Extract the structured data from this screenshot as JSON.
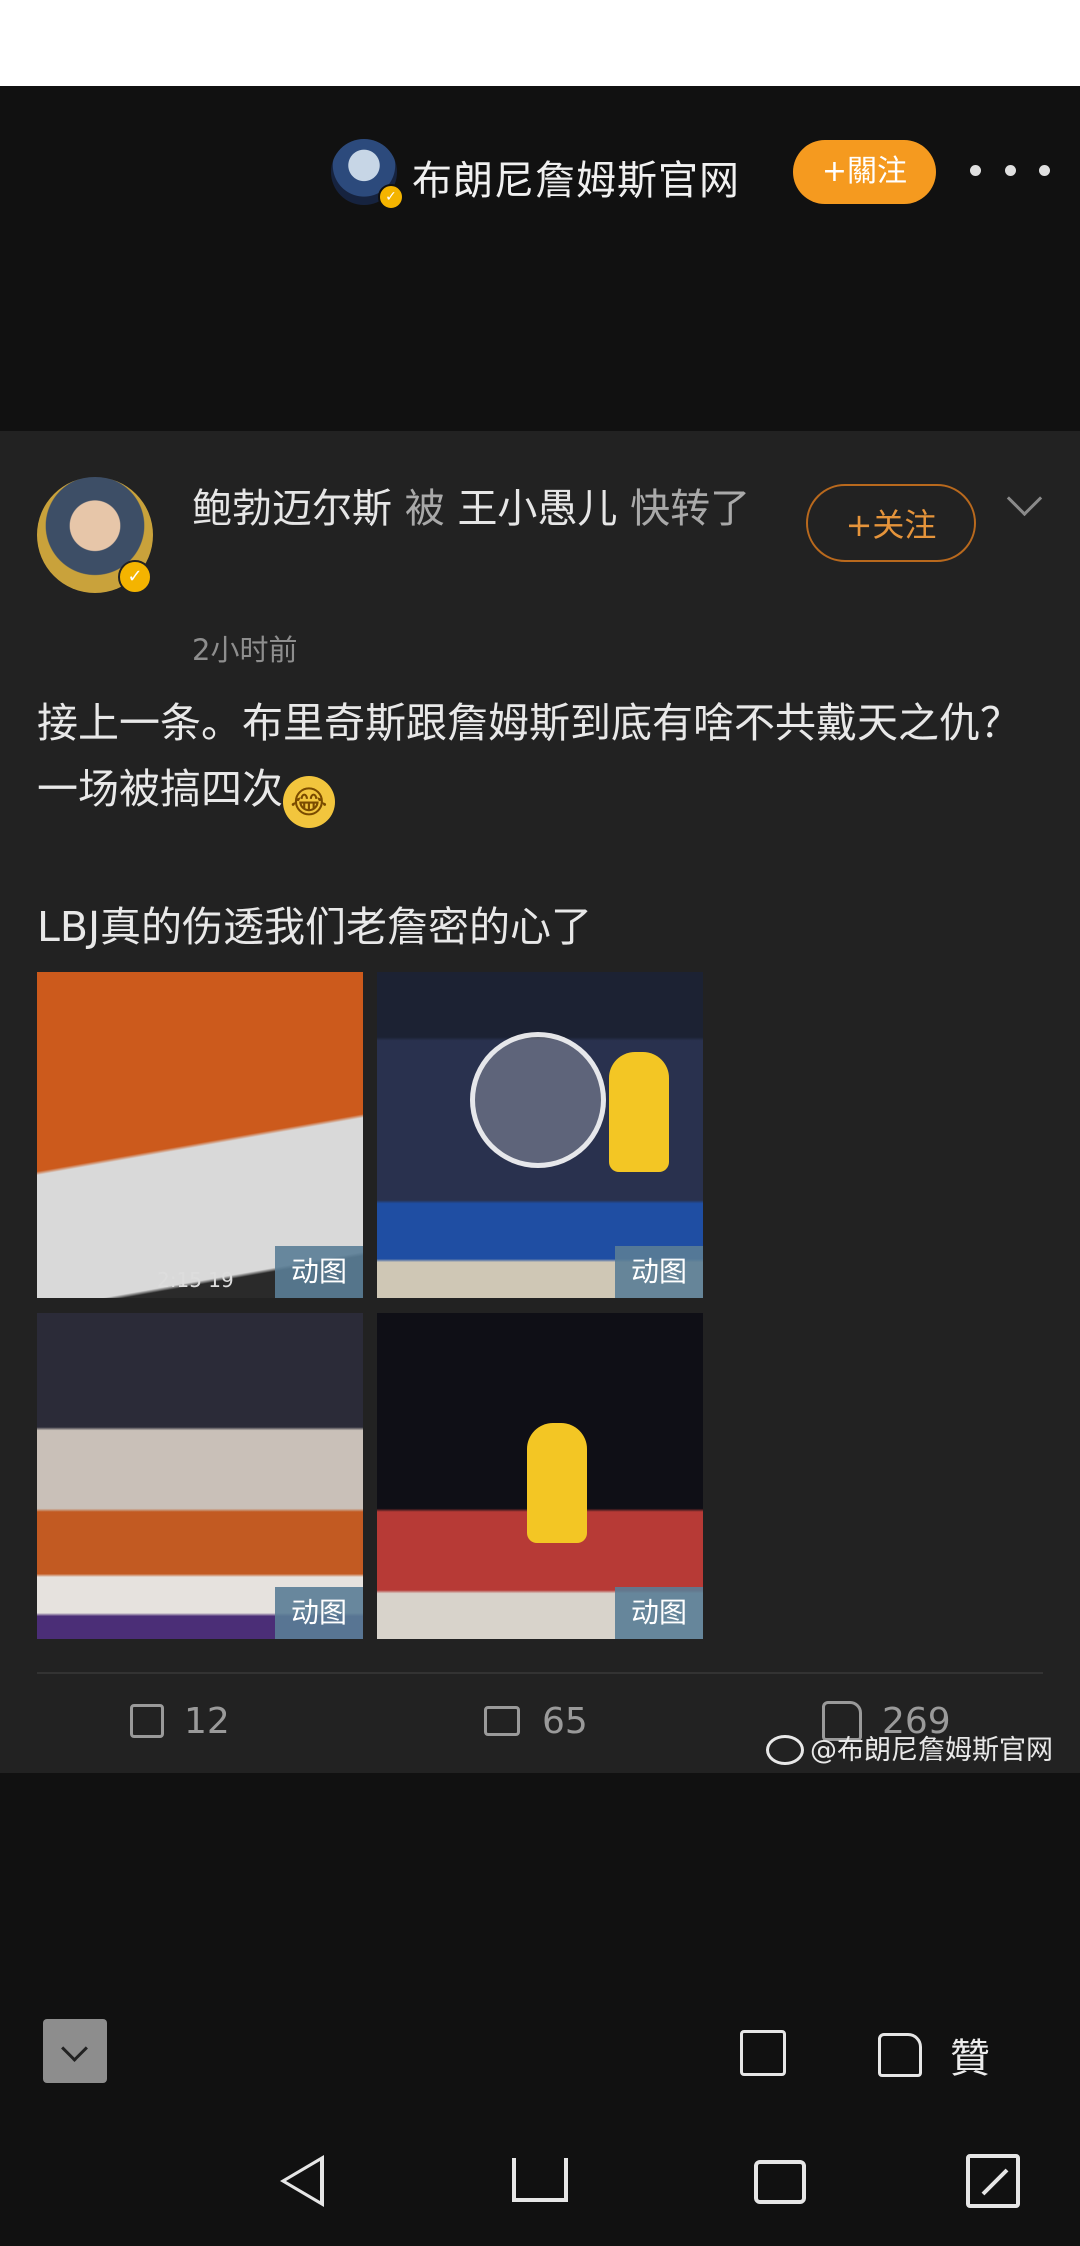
{
  "header": {
    "author_name": "布朗尼詹姆斯官网",
    "follow_label": "+關注"
  },
  "post": {
    "poster_name": "鲍勃迈尔斯",
    "by_word": "被",
    "forwarder_name": "王小愚儿",
    "forward_action": "快转了",
    "follow_label": "+关注",
    "timestamp": "2小时前",
    "text_line1": "接上一条。布里奇斯跟詹姆斯到底有啥不共戴天之仇？一场被搞四次",
    "text_line2": "LBJ真的伤透我们老詹密的心了",
    "images": [
      {
        "tag": "动图",
        "overlay_text": "2:15    19"
      },
      {
        "tag": "动图"
      },
      {
        "tag": "动图"
      },
      {
        "tag": "动图"
      }
    ],
    "actions": {
      "repost_count": "12",
      "comment_count": "65",
      "like_count": "269"
    },
    "watermark": "@布朗尼詹姆斯官网"
  },
  "footer": {
    "like_label": "贊"
  },
  "icons": [
    "verified-badge-icon",
    "more-options-icon",
    "chevron-down-icon",
    "repost-icon",
    "comment-icon",
    "like-icon",
    "weibo-logo-icon",
    "share-icon",
    "back-icon",
    "home-icon",
    "recent-apps-icon",
    "expand-icon"
  ],
  "colors": {
    "accent": "#f59a1f",
    "background": "#111111",
    "card": "#222222"
  }
}
